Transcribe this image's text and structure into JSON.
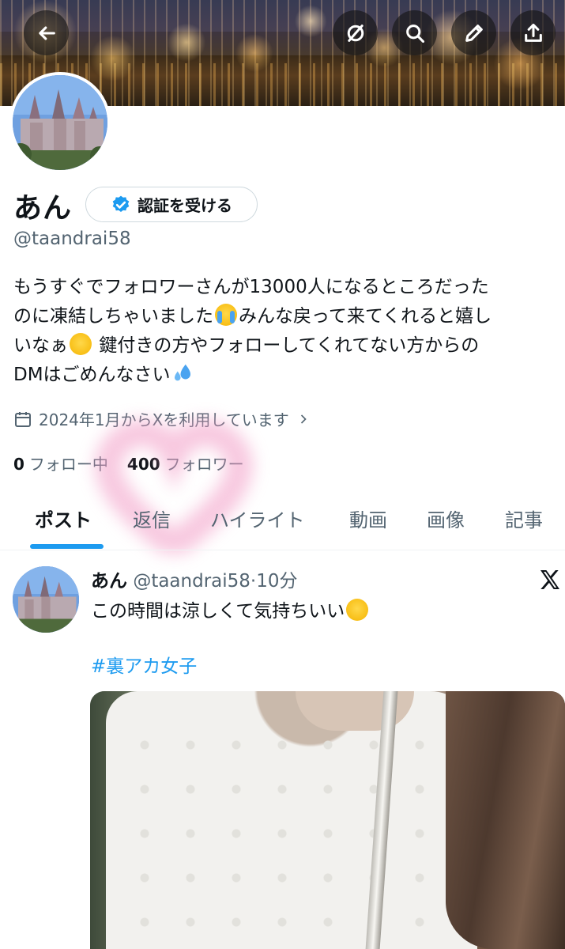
{
  "profile": {
    "name": "あん",
    "verify_label": "認証を受ける",
    "handle": "@taandrai58",
    "bio_lines": [
      "もうすぐでフォロワーさんが13000人になるところだった",
      "のに凍結しちゃいました",
      "みんな戻って来てくれると嬉し",
      "いなぁ",
      "鍵付きの方やフォローしてくれてない方からの",
      "DMはごめんなさい"
    ],
    "joined": "2024年1月からXを利用しています",
    "following_count": "0",
    "following_label": "フォロー中",
    "followers_count": "400",
    "followers_label": "フォロワー"
  },
  "header_buttons": [
    "back-icon",
    "mute-icon",
    "search-icon",
    "edit-icon",
    "share-icon"
  ],
  "tabs": [
    {
      "label": "ポスト",
      "active": true
    },
    {
      "label": "返信",
      "active": false
    },
    {
      "label": "ハイライト",
      "active": false
    },
    {
      "label": "動画",
      "active": false
    },
    {
      "label": "画像",
      "active": false
    },
    {
      "label": "記事",
      "active": false
    }
  ],
  "post": {
    "name": "あん",
    "handle": "@taandrai58",
    "separator": "·",
    "time": "10分",
    "text": "この時間は涼しくて気持ちいい",
    "hashtag": "#裏アカ女子"
  },
  "colors": {
    "accent": "#1d9bf0",
    "text": "#0f1419",
    "secondary": "#536471"
  }
}
